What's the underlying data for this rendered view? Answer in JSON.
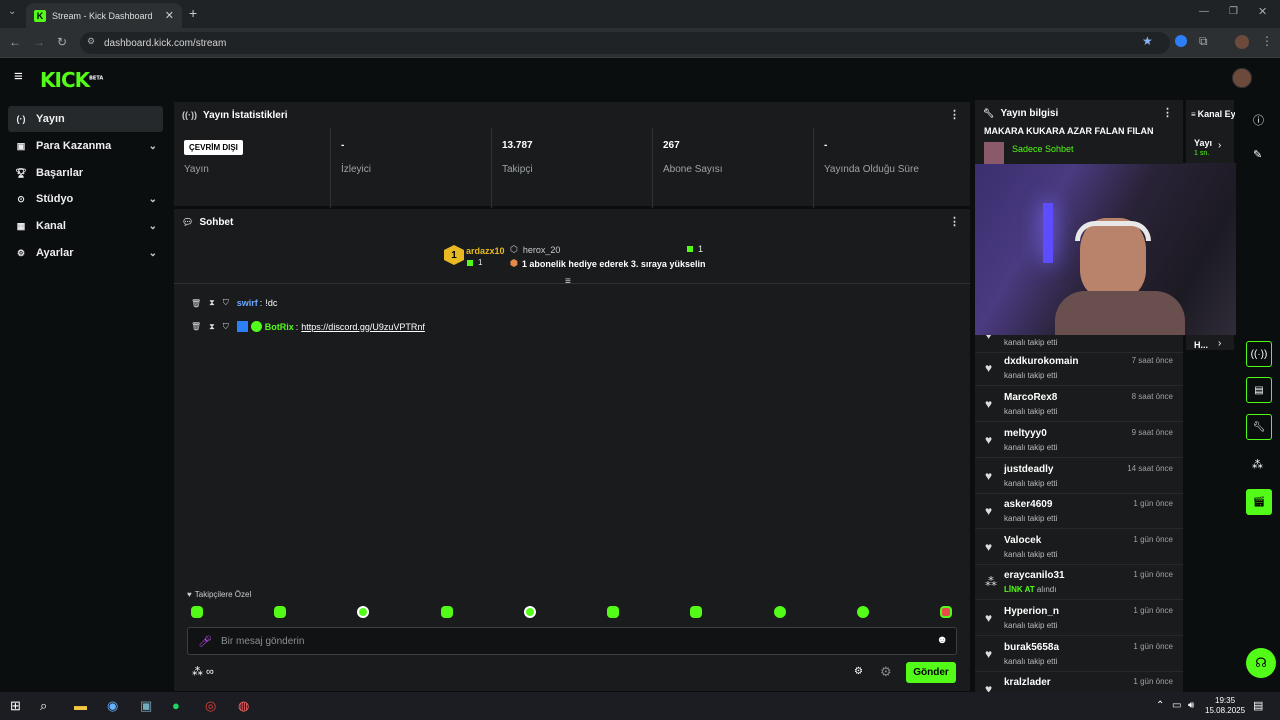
{
  "browser": {
    "tab_title": "Stream - Kick Dashboard",
    "url": "dashboard.kick.com/stream"
  },
  "header": {
    "logo": "KICK",
    "logo_badge": "BETA"
  },
  "sidebar": {
    "items": [
      {
        "label": "Yayın",
        "icon": "broadcast-icon"
      },
      {
        "label": "Para Kazanma",
        "icon": "money-icon"
      },
      {
        "label": "Başarılar",
        "icon": "trophy-icon"
      },
      {
        "label": "Stüdyo",
        "icon": "studio-icon"
      },
      {
        "label": "Kanal",
        "icon": "channel-icon"
      },
      {
        "label": "Ayarlar",
        "icon": "gear-icon"
      }
    ]
  },
  "stats": {
    "title": "Yayın İstatistikleri",
    "status_badge": "ÇEVRİM DIŞI",
    "items": [
      {
        "value": "",
        "label": "Yayın"
      },
      {
        "value": "-",
        "label": "İzleyici"
      },
      {
        "value": "13.787",
        "label": "Takipçi"
      },
      {
        "value": "267",
        "label": "Abone Sayısı"
      },
      {
        "value": "-",
        "label": "Yayında Olduğu Süre"
      }
    ]
  },
  "chat": {
    "title": "Sohbet",
    "pinned": {
      "rank": "1",
      "gifter": "ardazx10",
      "gifter_count": "1",
      "user": "herox_20",
      "user_count": "1",
      "message": "1 abonelik hediye ederek 3. sıraya yükselin"
    },
    "messages": [
      {
        "user": "swirf",
        "text": "!dc",
        "color": "#6ea8ff"
      },
      {
        "user": "BotRix",
        "text": "https://discord.gg/U9zuVPTRnf",
        "color": "#53fc18"
      }
    ],
    "followers_only": "Takipçilere Özel",
    "input_placeholder": "Bir mesaj gönderin",
    "send_label": "Gönder"
  },
  "stream_info": {
    "title": "Yayın bilgisi",
    "stream_title": "MAKARA KUKARA AZAR FALAN FILAN",
    "category": "Sadece Sohbet"
  },
  "channel_actions": {
    "title": "Kanal Eylemleri",
    "item1": "Yayı",
    "item1_sub": "1 sn.",
    "item2": "H..."
  },
  "feed": [
    {
      "name": "",
      "action": "kanalı takip etti",
      "time": ""
    },
    {
      "name": "dxdkurokomain",
      "action": "kanalı takip etti",
      "time": "7 saat önce"
    },
    {
      "name": "MarcoRex8",
      "action": "kanalı takip etti",
      "time": "8 saat önce"
    },
    {
      "name": "meltyyy0",
      "action": "kanalı takip etti",
      "time": "9 saat önce"
    },
    {
      "name": "justdeadly",
      "action": "kanalı takip etti",
      "time": "14 saat önce"
    },
    {
      "name": "asker4609",
      "action": "kanalı takip etti",
      "time": "1 gün önce"
    },
    {
      "name": "Valocek",
      "action": "kanalı takip etti",
      "time": "1 gün önce"
    },
    {
      "name": "eraycanilo31",
      "action_highlight": "LİNK AT",
      "action": "alındı",
      "time": "1 gün önce"
    },
    {
      "name": "Hyperion_n",
      "action": "kanalı takip etti",
      "time": "1 gün önce"
    },
    {
      "name": "burak5658a",
      "action": "kanalı takip etti",
      "time": "1 gün önce"
    },
    {
      "name": "kralzlader",
      "action": "",
      "time": "1 gün önce"
    }
  ],
  "taskbar": {
    "time": "19:35",
    "date": "15.08.2025"
  },
  "colors": {
    "accent": "#53fc18",
    "bg": "#0b0e0f",
    "panel": "#191b1c"
  }
}
